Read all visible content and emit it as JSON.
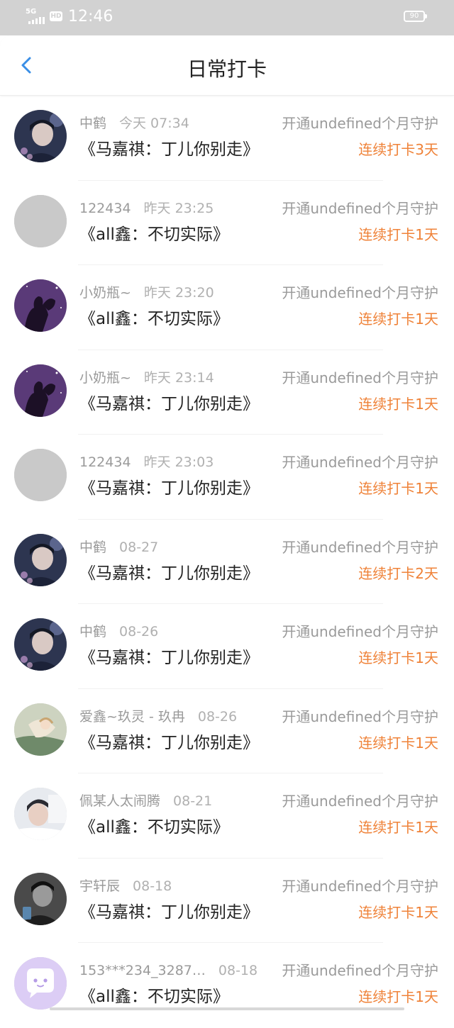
{
  "status_bar": {
    "network": "5G",
    "hd_badge": "HD",
    "time": "12:46",
    "battery": "90"
  },
  "header": {
    "back_icon": "chevron-left-icon",
    "title": "日常打卡",
    "accent_color": "#3a8ee6"
  },
  "streak_color": "#ef8238",
  "checkins": [
    {
      "name": "中鹤",
      "time": "今天 07:34",
      "guard": "开通undefined个月守护",
      "book": "《马嘉祺：丁儿你别走》",
      "streak": "连续打卡3天",
      "avatar": "dark-portrait"
    },
    {
      "name": "122434",
      "time": "昨天 23:25",
      "guard": "开通undefined个月守护",
      "book": "《all鑫：不切实际》",
      "streak": "连续打卡1天",
      "avatar": "placeholder-grey"
    },
    {
      "name": "小奶瓶~",
      "time": "昨天 23:20",
      "guard": "开通undefined个月守护",
      "book": "《all鑫：不切实际》",
      "streak": "连续打卡1天",
      "avatar": "purple-silhouette"
    },
    {
      "name": "小奶瓶~",
      "time": "昨天 23:14",
      "guard": "开通undefined个月守护",
      "book": "《马嘉祺：丁儿你别走》",
      "streak": "连续打卡1天",
      "avatar": "purple-silhouette"
    },
    {
      "name": "122434",
      "time": "昨天 23:03",
      "guard": "开通undefined个月守护",
      "book": "《马嘉祺：丁儿你别走》",
      "streak": "连续打卡1天",
      "avatar": "placeholder-grey"
    },
    {
      "name": "中鹤",
      "time": "08-27",
      "guard": "开通undefined个月守护",
      "book": "《马嘉祺：丁儿你别走》",
      "streak": "连续打卡2天",
      "avatar": "dark-portrait"
    },
    {
      "name": "中鹤",
      "time": "08-26",
      "guard": "开通undefined个月守护",
      "book": "《马嘉祺：丁儿你别走》",
      "streak": "连续打卡1天",
      "avatar": "dark-portrait"
    },
    {
      "name": "爱鑫~玖灵 - 玖冉",
      "time": "08-26",
      "guard": "开通undefined个月守护",
      "book": "《马嘉祺：丁儿你别走》",
      "streak": "连续打卡1天",
      "avatar": "illustration"
    },
    {
      "name": "佩某人太闹腾",
      "time": "08-21",
      "guard": "开通undefined个月守护",
      "book": "《all鑫：不切实际》",
      "streak": "连续打卡1天",
      "avatar": "light-portrait"
    },
    {
      "name": "宇轩辰",
      "time": "08-18",
      "guard": "开通undefined个月守护",
      "book": "《马嘉祺：丁儿你别走》",
      "streak": "连续打卡1天",
      "avatar": "grey-portrait"
    },
    {
      "name": "153***234_3287…",
      "time": "08-18",
      "guard": "开通undefined个月守护",
      "book": "《all鑫：不切实际》",
      "streak": "连续打卡1天",
      "avatar": "chat-bubble-default"
    }
  ]
}
